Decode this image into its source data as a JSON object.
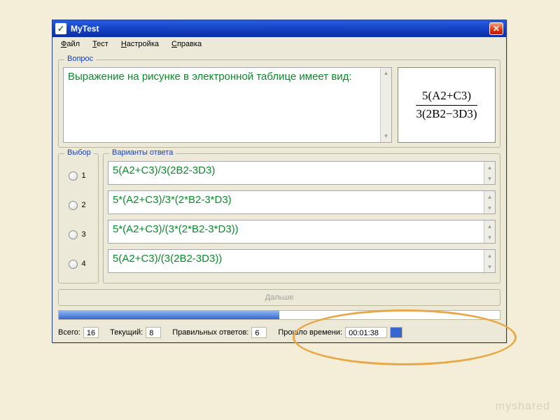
{
  "window": {
    "title": "MyTest"
  },
  "menu": {
    "file": "Файл",
    "test": "Тест",
    "settings": "Настройка",
    "help": "Справка"
  },
  "groups": {
    "question": "Вопрос",
    "choice": "Выбор",
    "answers": "Варианты ответа"
  },
  "question": {
    "text": "Выражение на рисунке в электронной таблице имеет вид:"
  },
  "formula": {
    "numerator": "5(A2+C3)",
    "denominator": "3(2B2−3D3)"
  },
  "choices": [
    "1",
    "2",
    "3",
    "4"
  ],
  "answers": [
    "5(A2+C3)/3(2B2-3D3)",
    "5*(A2+C3)/3*(2*B2-3*D3)",
    "5*(A2+C3)/(3*(2*B2-3*D3))",
    "5(A2+C3)/(3(2B2-3D3))"
  ],
  "buttons": {
    "next": "Дальше"
  },
  "progress": {
    "percent": 50
  },
  "status": {
    "total_label": "Всего:",
    "total_val": "16",
    "current_label": "Текущий:",
    "current_val": "8",
    "correct_label": "Правильных ответов:",
    "correct_val": "6",
    "elapsed_label": "Прошло времени:",
    "elapsed_val": "00:01:38"
  },
  "watermark": "myshared"
}
